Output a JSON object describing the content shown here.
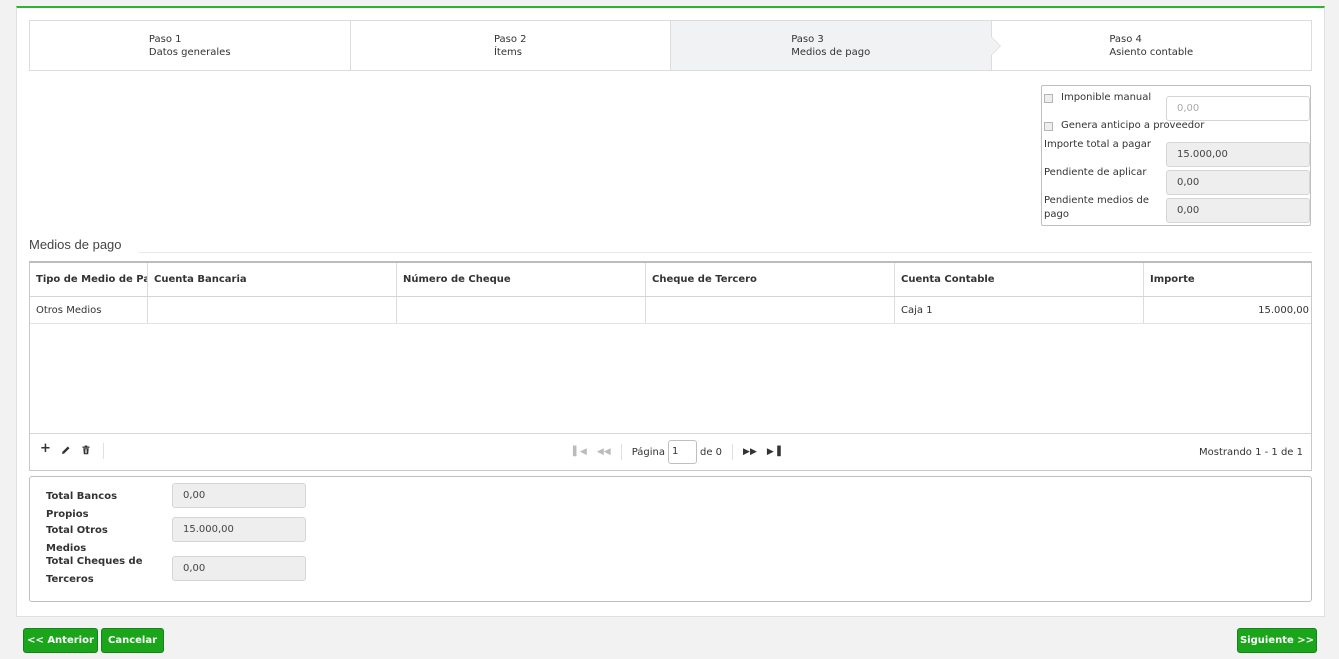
{
  "wizard": {
    "steps": [
      {
        "num": "Paso 1",
        "title": "Datos generales"
      },
      {
        "num": "Paso 2",
        "title": "Ítems"
      },
      {
        "num": "Paso 3",
        "title": "Medios de pago"
      },
      {
        "num": "Paso 4",
        "title": "Asiento contable"
      }
    ],
    "active_step": 3
  },
  "summary": {
    "imponible_label": "Imponible manual",
    "imponible_value": "0,00",
    "anticipo_label": "Genera anticipo a proveedor",
    "importe_total_label": "Importe total a pagar",
    "importe_total_value": "15.000,00",
    "pendiente_aplicar_label": "Pendiente de aplicar",
    "pendiente_aplicar_value": "0,00",
    "pendiente_medios_label": "Pendiente medios de pago",
    "pendiente_medios_value": "0,00"
  },
  "section": {
    "title": "Medios de pago"
  },
  "grid": {
    "columns": [
      "Tipo de Medio de Pago",
      "Cuenta Bancaria",
      "Número de Cheque",
      "Cheque de Tercero",
      "Cuenta Contable",
      "Importe"
    ],
    "rows": [
      {
        "tipo": "Otros Medios",
        "cuenta_bancaria": "",
        "numero_cheque": "",
        "cheque_tercero": "",
        "cuenta_contable": "Caja 1",
        "importe": "15.000,00"
      }
    ],
    "pager": {
      "page_label": "Página",
      "page_value": "1",
      "of_label": "de 0",
      "showing": "Mostrando 1 - 1 de 1"
    }
  },
  "totals": {
    "bancos_label": "Total Bancos Propios",
    "bancos_value": "0,00",
    "otros_label": "Total Otros Medios",
    "otros_value": "15.000,00",
    "cheques_label": "Total Cheques de Terceros",
    "cheques_value": "0,00"
  },
  "buttons": {
    "anterior": "<< Anterior",
    "cancelar": "Cancelar",
    "siguiente": "Siguiente >>"
  },
  "colors": {
    "accent": "#1aa51a",
    "top_border": "#2bb52b"
  },
  "icons": [
    "add-icon",
    "edit-icon",
    "delete-icon",
    "first-page-icon",
    "prev-page-icon",
    "next-page-icon",
    "last-page-icon"
  ]
}
